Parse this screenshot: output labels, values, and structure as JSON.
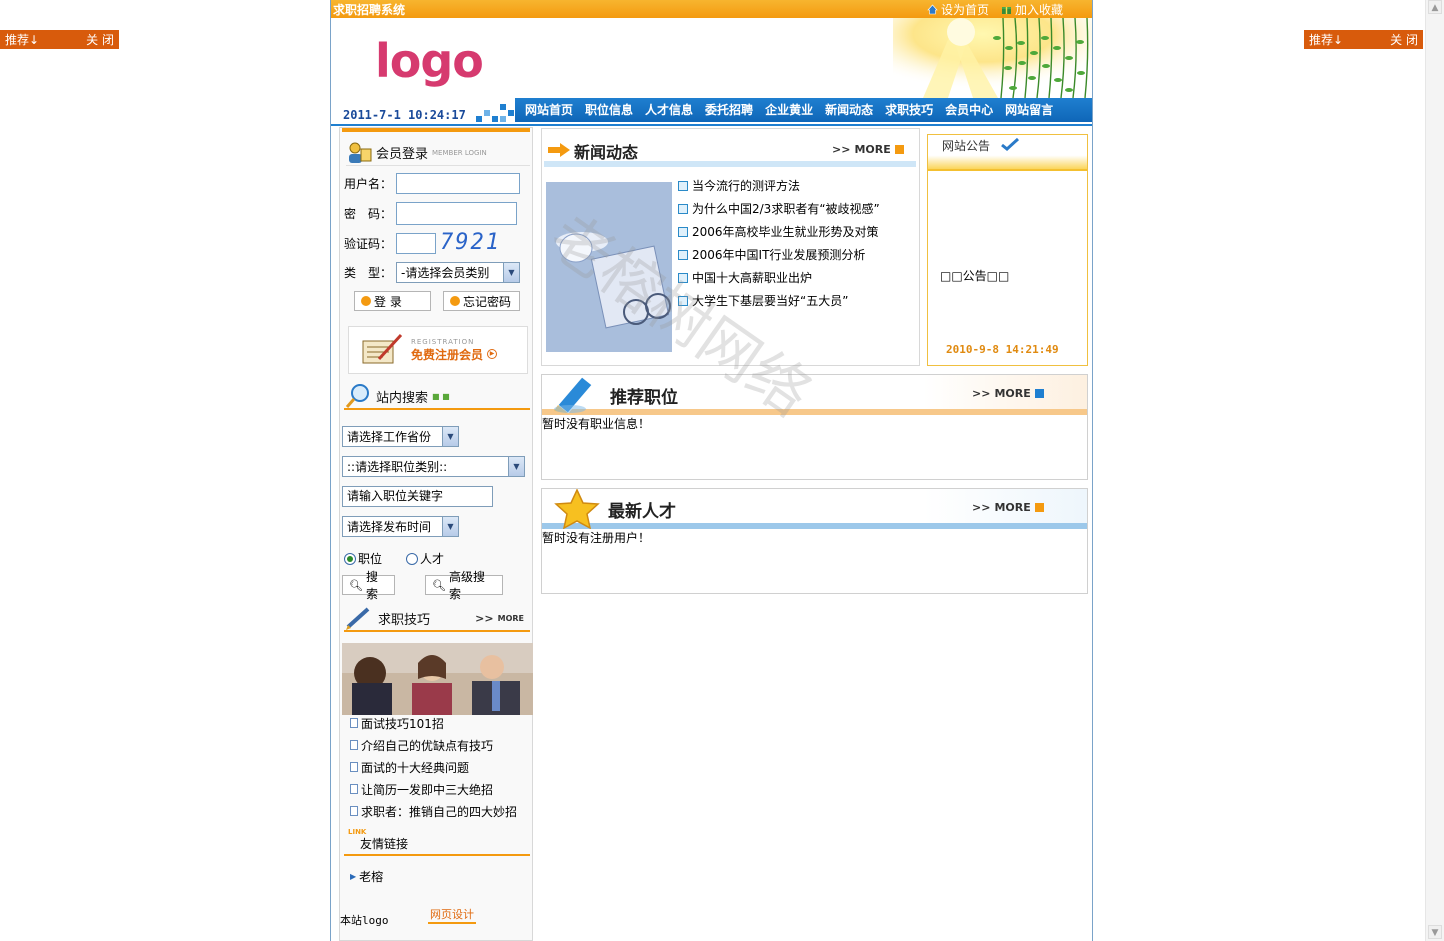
{
  "float_left": {
    "recommend": "推荐↓",
    "close": "关 闭"
  },
  "float_right": {
    "recommend": "推荐↓",
    "close": "关 闭"
  },
  "topbar": {
    "site_name": "求职招聘系统",
    "set_home": "设为首页",
    "add_favorite": "加入收藏"
  },
  "header": {
    "logo_text": "logo",
    "datetime": "2011-7-1 10:24:17"
  },
  "nav": [
    "网站首页",
    "职位信息",
    "人才信息",
    "委托招聘",
    "企业黄业",
    "新闻动态",
    "求职技巧",
    "会员中心",
    "网站留言"
  ],
  "login": {
    "title": "会员登录",
    "title_en": "MEMBER LOGIN",
    "username_label": "用户名：",
    "password_label": "密　码：",
    "captcha_label": "验证码：",
    "captcha_value": "7921",
    "type_label": "类　型：",
    "type_selected": "-请选择会员类别",
    "login_button": "登 录",
    "forgot_button": "忘记密码",
    "register_en": "REGISTRATION",
    "register_label": "免费注册会员"
  },
  "search": {
    "title": "站内搜索",
    "province_selected": "请选择工作省份",
    "category_selected": "::请选择职位类别::",
    "keyword_placeholder": "请输入职位关键字",
    "time_selected": "请选择发布时间",
    "radio_job": "职位",
    "radio_talent": "人才",
    "search_button": "搜索",
    "advanced_button": "高级搜索"
  },
  "tips": {
    "title": "求职技巧",
    "more": "MORE",
    "items": [
      "面试技巧101招",
      "介绍自己的优缺点有技巧",
      "面试的十大经典问题",
      "让简历一发即中三大绝招",
      "求职者：推销自己的四大妙招"
    ]
  },
  "links": {
    "title_en": "LINK",
    "title": "友情链接",
    "items": [
      "老榕"
    ],
    "site_logo": "本站logo",
    "design_logo": "网页设计"
  },
  "news": {
    "title": "新闻动态",
    "more": "MORE",
    "items": [
      "当今流行的测评方法",
      "为什么中国2/3求职者有“被歧视感”",
      "2006年高校毕业生就业形势及对策",
      "2006年中国IT行业发展预测分析",
      "中国十大高薪职业出炉",
      "大学生下基层要当好“五大员”"
    ]
  },
  "notice": {
    "title": "网站公告",
    "content": "□□公告□□",
    "date": "2010-9-8 14:21:49"
  },
  "jobs": {
    "title": "推荐职位",
    "more": "MORE",
    "empty": "暂时没有职业信息！"
  },
  "talent": {
    "title": "最新人才",
    "more": "MORE",
    "empty": "暂时没有注册用户！"
  },
  "watermark": "老榕树网络",
  "colors": {
    "nav": "#0f66b8",
    "topbar": "#f49a10",
    "float": "#d85b0c",
    "logo": "#d63a6f"
  }
}
